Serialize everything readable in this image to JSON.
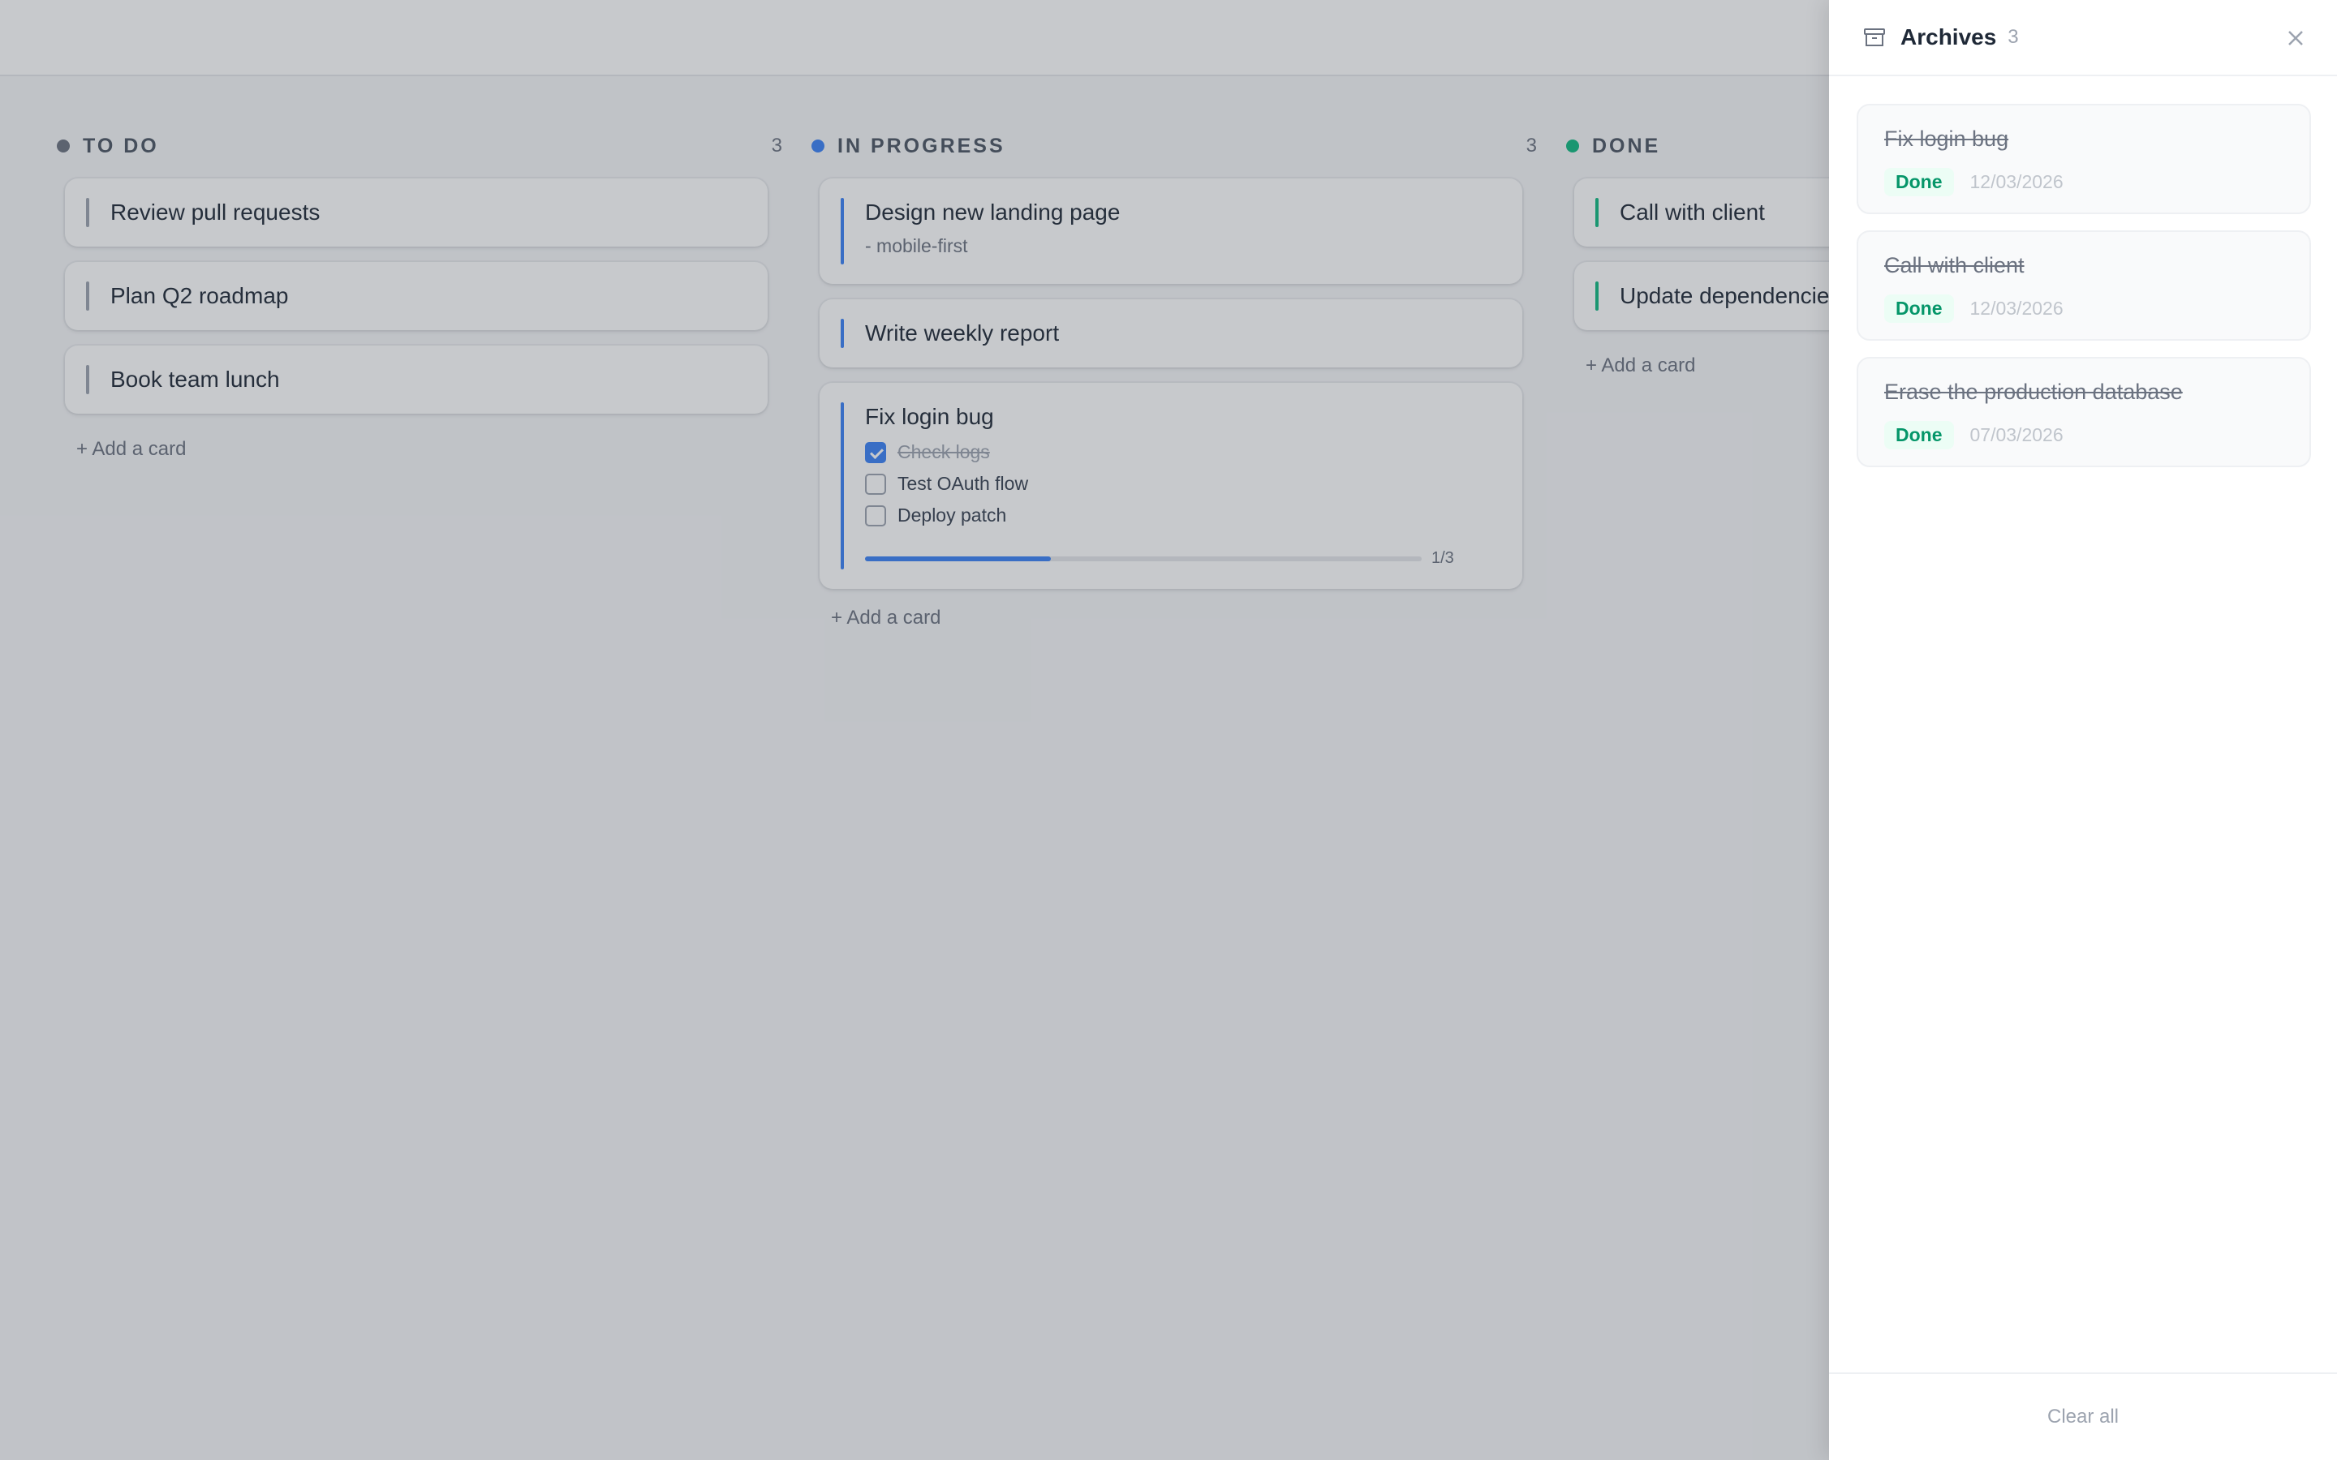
{
  "colors": {
    "todo": "#6b7280",
    "progress": "#3b82f6",
    "done": "#10b981",
    "todo_bar": "#9ca3af"
  },
  "board": {
    "columns": [
      {
        "title": "TO DO",
        "count": "3",
        "cards": [
          {
            "title": "Review pull requests"
          },
          {
            "title": "Plan Q2 roadmap"
          },
          {
            "title": "Book team lunch"
          }
        ],
        "add_label": "+ Add a card"
      },
      {
        "title": "IN PROGRESS",
        "count": "3",
        "cards": [
          {
            "title": "Design new landing page",
            "subtitle": "- mobile-first"
          },
          {
            "title": "Write weekly report"
          },
          {
            "title": "Fix login bug",
            "checklist": [
              {
                "label": "Check logs",
                "checked": true
              },
              {
                "label": "Test OAuth flow",
                "checked": false
              },
              {
                "label": "Deploy patch",
                "checked": false
              }
            ],
            "progress": 0.3333,
            "progress_label": "1/3"
          }
        ],
        "add_label": "+ Add a card"
      },
      {
        "title": "DONE",
        "count": "",
        "cards": [
          {
            "title": "Call with client"
          },
          {
            "title": "Update dependencies"
          }
        ],
        "add_label": "+ Add a card"
      }
    ]
  },
  "archives": {
    "icon": "archive-box-icon",
    "title": "Archives",
    "count": "3",
    "items": [
      {
        "title": "Fix login bug",
        "status": "Done",
        "date": "12/03/2026"
      },
      {
        "title": "Call with client",
        "status": "Done",
        "date": "12/03/2026"
      },
      {
        "title": "Erase the production database",
        "status": "Done",
        "date": "07/03/2026"
      }
    ],
    "clear_label": "Clear all"
  }
}
